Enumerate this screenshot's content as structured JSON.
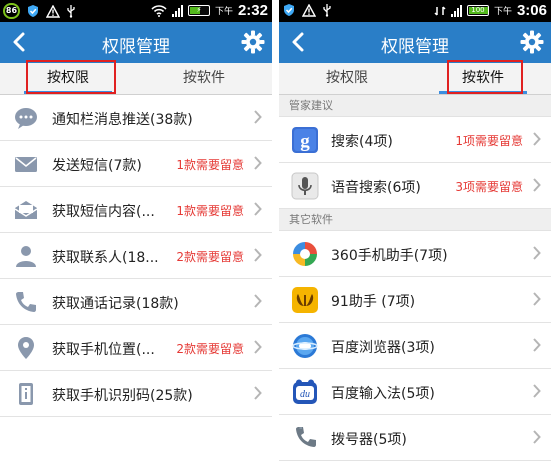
{
  "left": {
    "status": {
      "notification_count": "86",
      "time": "2:32",
      "ampm": "下午"
    },
    "header": {
      "title": "权限管理"
    },
    "tabs": [
      {
        "label": "按权限",
        "active": true
      },
      {
        "label": "按软件",
        "active": false
      }
    ],
    "rows": [
      {
        "icon": "message-bubble-icon",
        "label": "通知栏消息推送(38款)",
        "warning": ""
      },
      {
        "icon": "envelope-icon",
        "label": "发送短信(7款)",
        "warning": "1款需要留意"
      },
      {
        "icon": "envelope-open-icon",
        "label": "获取短信内容(...",
        "warning": "1款需要留意"
      },
      {
        "icon": "contact-person-icon",
        "label": "获取联系人(18...",
        "warning": "2款需要留意"
      },
      {
        "icon": "phone-handset-icon",
        "label": "获取通话记录(18款)",
        "warning": ""
      },
      {
        "icon": "location-pin-icon",
        "label": "获取手机位置(...",
        "warning": "2款需要留意"
      },
      {
        "icon": "device-id-icon",
        "label": "获取手机识别码(25款)",
        "warning": ""
      }
    ]
  },
  "right": {
    "status": {
      "time": "3:06",
      "ampm": "下午",
      "battery": "100"
    },
    "header": {
      "title": "权限管理"
    },
    "tabs": [
      {
        "label": "按权限",
        "active": false
      },
      {
        "label": "按软件",
        "active": true
      }
    ],
    "sections": [
      {
        "title": "管家建议",
        "rows": [
          {
            "icon": "google-search-icon",
            "label": "搜索(4项)",
            "warning": "1项需要留意"
          },
          {
            "icon": "microphone-icon",
            "label": "语音搜索(6项)",
            "warning": "3项需要留意"
          }
        ]
      },
      {
        "title": "其它软件",
        "rows": [
          {
            "icon": "360-assistant-icon",
            "label": "360手机助手(7项)",
            "warning": ""
          },
          {
            "icon": "91-assistant-icon",
            "label": "91助手 (7项)",
            "warning": ""
          },
          {
            "icon": "baidu-browser-icon",
            "label": "百度浏览器(3项)",
            "warning": ""
          },
          {
            "icon": "baidu-input-icon",
            "label": "百度输入法(5项)",
            "warning": ""
          },
          {
            "icon": "dialer-icon",
            "label": "拨号器(5项)",
            "warning": ""
          }
        ]
      }
    ]
  },
  "colors": {
    "titlebar": "#2a7ec7",
    "warning": "#e53935",
    "tab_indicator": "#3b8ee0",
    "highlight_box": "#e02020"
  }
}
